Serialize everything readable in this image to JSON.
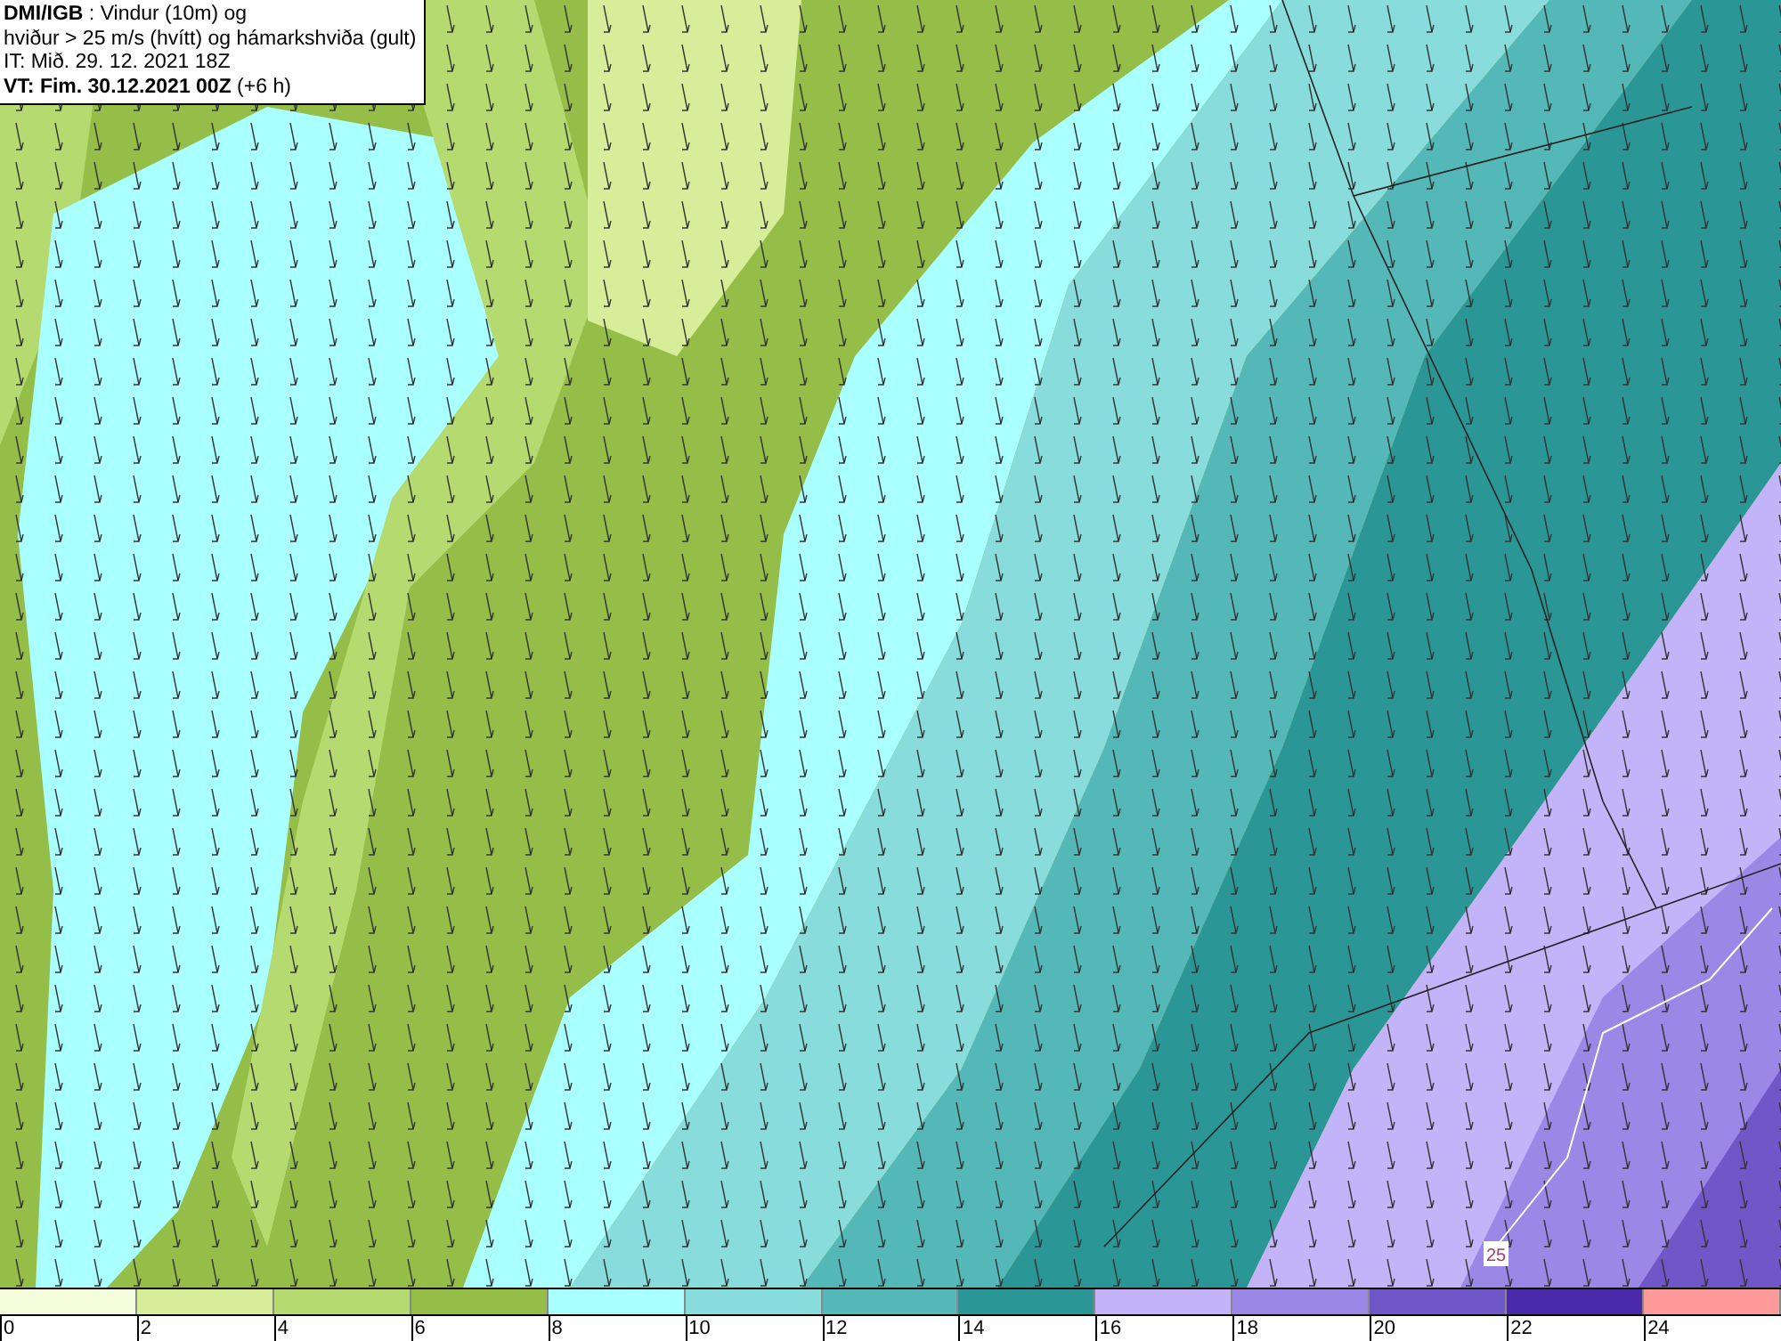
{
  "header": {
    "lines": [
      "**DMI/IGB** : Vindur (10m) og",
      "hviður > 25 m/s (hvítt) og hámarkshviða (gult)",
      "IT: Mið. 29. 12. 2021 18Z",
      "**VT: Fim. 30.12.2021 00Z** (+6 h)"
    ]
  },
  "map": {
    "contour_label": "25"
  },
  "legend": {
    "bins": [
      {
        "color": "#f5fcdc"
      },
      {
        "color": "#d6ee9a"
      },
      {
        "color": "#b4da70"
      },
      {
        "color": "#94be48"
      },
      {
        "color": "#aaffff"
      },
      {
        "color": "#88dcdc"
      },
      {
        "color": "#55b8b8"
      },
      {
        "color": "#2a9696"
      },
      {
        "color": "#c3b4fa"
      },
      {
        "color": "#9a87e6"
      },
      {
        "color": "#7057c8"
      },
      {
        "color": "#4a2aa8"
      },
      {
        "color": "#ff9a9a"
      }
    ],
    "ticks": [
      "0",
      "2",
      "4",
      "6",
      "8",
      "10",
      "12",
      "14",
      "16",
      "18",
      "20",
      "22",
      "24"
    ]
  }
}
